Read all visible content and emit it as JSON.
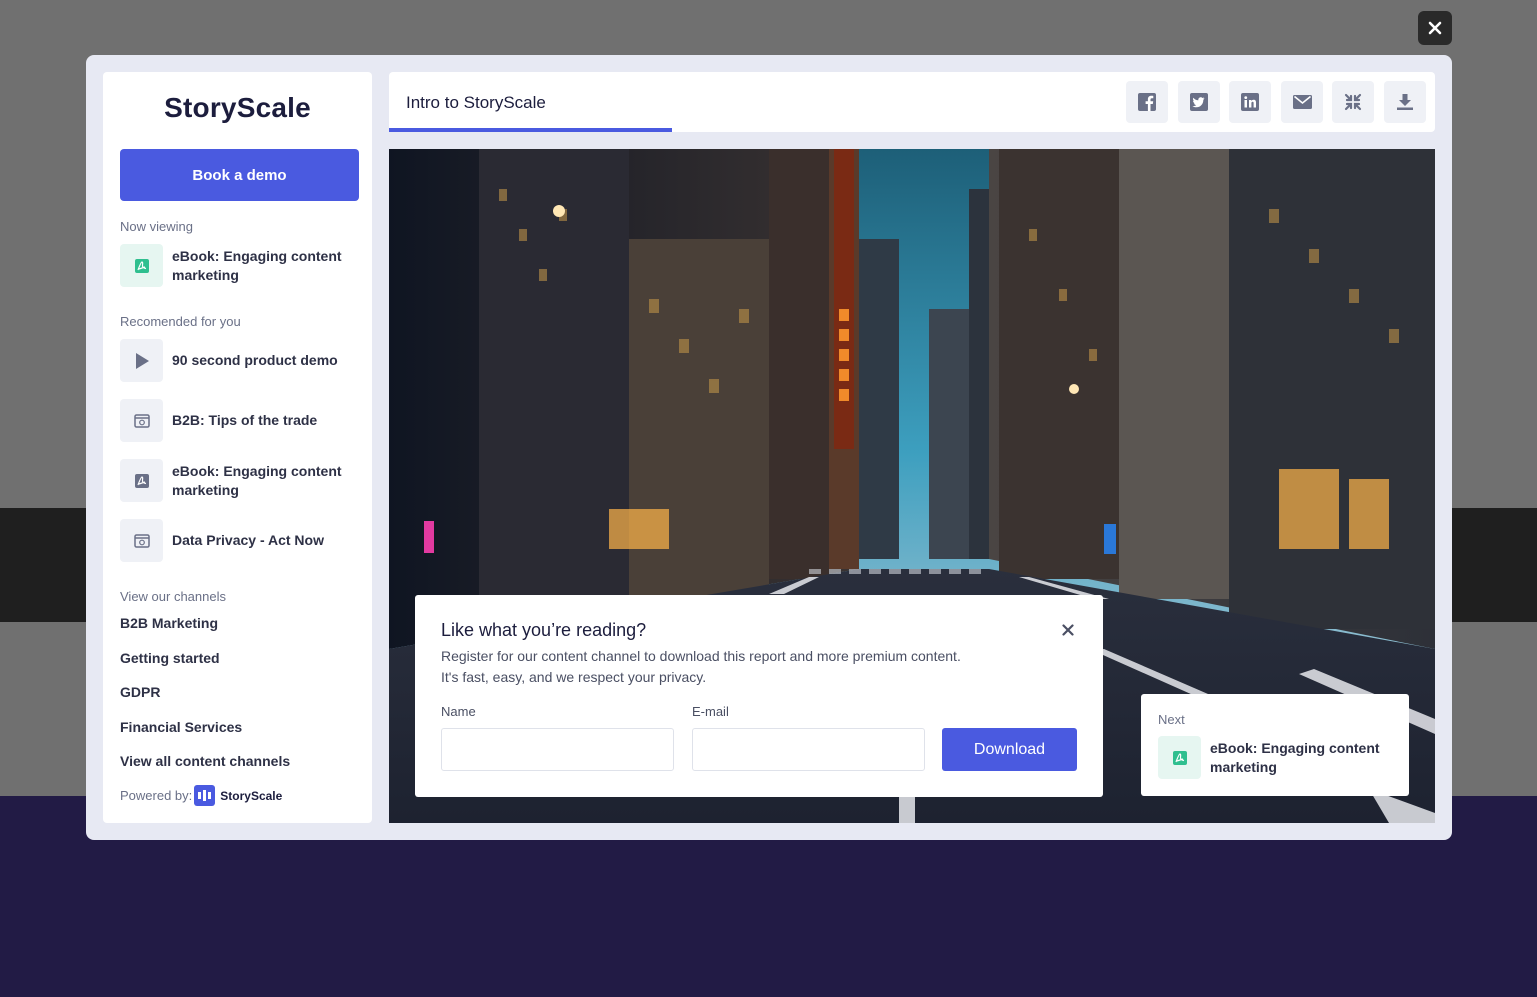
{
  "overlay": {
    "close_icon": "close-icon"
  },
  "sidebar": {
    "logo": "StoryScale",
    "book_demo_label": "Book a demo",
    "now_viewing_label": "Now viewing",
    "now_viewing_item": {
      "title": "eBook: Engaging content marketing",
      "icon": "pdf-icon"
    },
    "recommended_label": "Recomended for you",
    "recommended": [
      {
        "title": "90 second product demo",
        "icon": "play-icon"
      },
      {
        "title": "B2B: Tips of the trade",
        "icon": "web-page-icon"
      },
      {
        "title": "eBook: Engaging content marketing",
        "icon": "pdf-icon"
      },
      {
        "title": "Data Privacy - Act Now",
        "icon": "web-page-icon"
      }
    ],
    "channels_label": "View our channels",
    "channels": [
      "B2B Marketing",
      "Getting started",
      "GDPR",
      "Financial Services",
      "View all content channels"
    ],
    "powered_by_label": "Powered by:",
    "powered_by_brand": "StoryScale"
  },
  "header": {
    "title": "Intro to StoryScale",
    "actions": [
      "facebook-icon",
      "twitter-icon",
      "linkedin-icon",
      "email-icon",
      "fullscreen-icon",
      "download-icon"
    ]
  },
  "register_dialog": {
    "title": "Like what you’re reading?",
    "line1": "Register for our content channel to download this report and more premium content.",
    "line2": "It's fast, easy, and we respect your privacy.",
    "name_label": "Name",
    "name_value": "",
    "email_label": "E-mail",
    "email_value": "",
    "download_label": "Download"
  },
  "next_card": {
    "label": "Next",
    "title": "eBook: Engaging content marketing",
    "icon": "pdf-icon"
  },
  "colors": {
    "accent": "#4a5ae0",
    "pdf_icon": "#2fbf8f",
    "text_dark": "#1c1d3d",
    "page_purple": "#221b45"
  }
}
